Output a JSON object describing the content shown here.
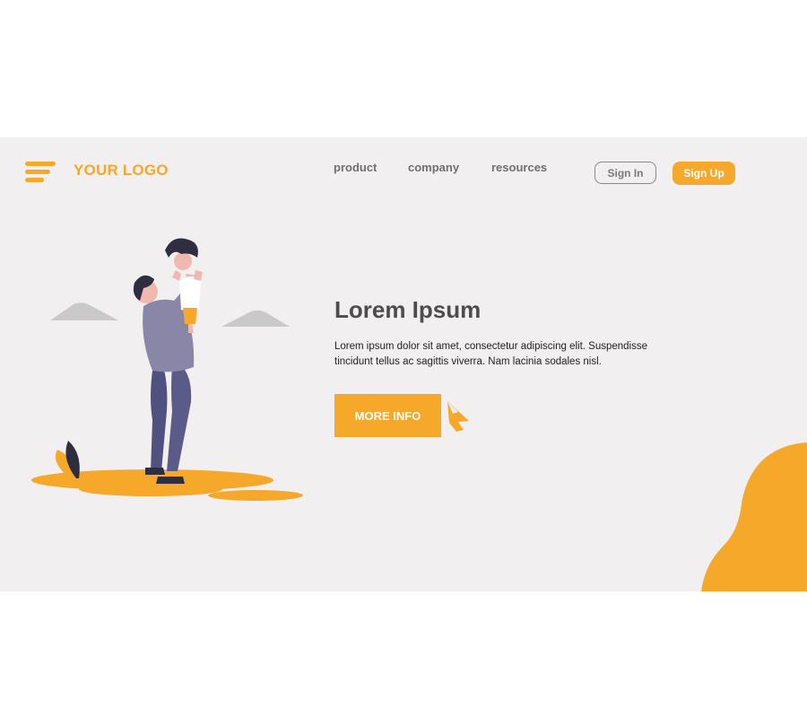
{
  "header": {
    "logo_text": "YOUR LOGO",
    "nav": [
      "product",
      "company",
      "resources"
    ],
    "sign_in_label": "Sign In",
    "sign_up_label": "Sign Up"
  },
  "hero": {
    "title": "Lorem Ipsum",
    "body": "Lorem ipsum dolor sit amet, consectetur adipiscing elit. Suspendisse tincidunt tellus ac sagittis viverra. Nam lacinia sodales nisl.",
    "cta_label": "MORE INFO"
  },
  "icons": [
    "menu-icon",
    "cursor-pointer-icon"
  ],
  "colors": {
    "accent": "#f6a82a",
    "background": "#f1efef",
    "text_dark": "#4d4d4d",
    "text_muted": "#6f6f6f"
  }
}
